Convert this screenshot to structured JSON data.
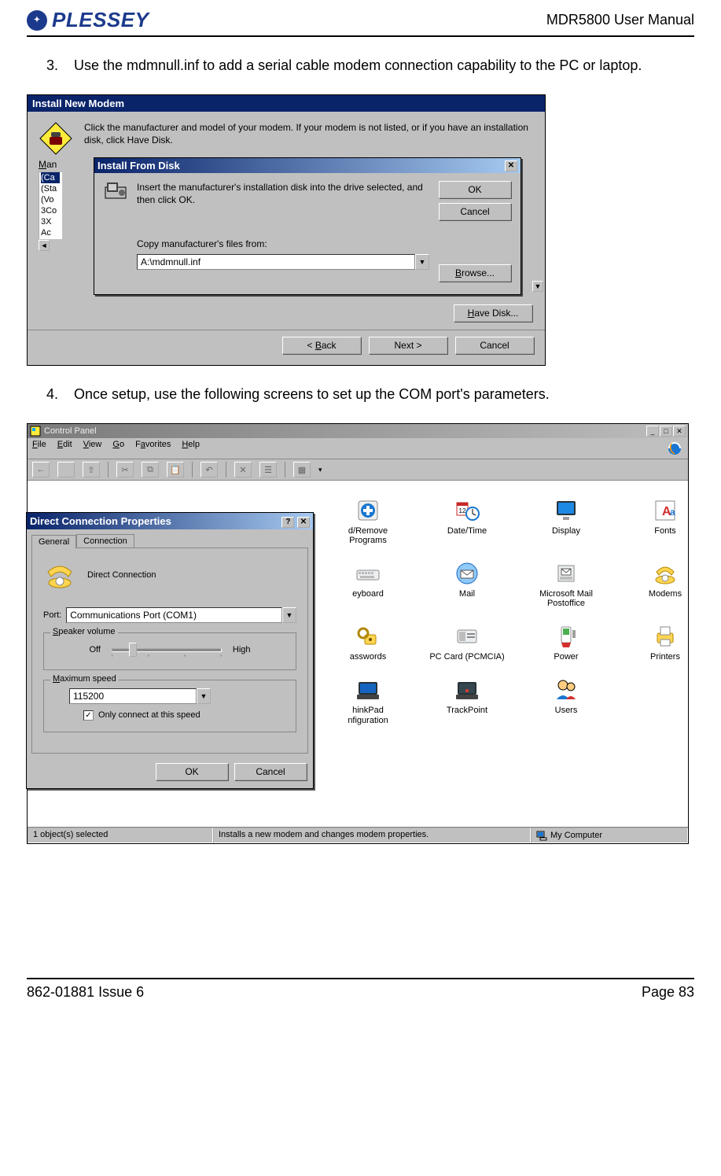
{
  "header": {
    "brand": "PLESSEY",
    "doc_title": "MDR5800 User Manual"
  },
  "footer": {
    "left": "862-01881 Issue 6",
    "right": "Page 83"
  },
  "step3": {
    "num": "3.",
    "text": "Use the mdmnull.inf to add a serial cable modem connection capability to the PC or laptop."
  },
  "step4": {
    "num": "4.",
    "text": "Once setup, use the following screens to set up the COM port's parameters."
  },
  "shot1": {
    "outer_title": "Install New Modem",
    "hint": "Click the manufacturer and model of your modem. If your modem is not listed, or if you have an installation disk, click Have Disk.",
    "mfr_label_u": "M",
    "mfr_label_rest": "an",
    "mfr_items": [
      "(Ca",
      "(Sta",
      "(Vo",
      "3Co",
      "3X",
      "Ac"
    ],
    "inner_title": "Install From Disk",
    "inner_hint": "Insert the manufacturer's installation disk into the drive selected, and then click OK.",
    "copy_from": "Copy manufacturer's files from:",
    "path_value": "A:\\mdmnull.inf",
    "ok": "OK",
    "cancel": "Cancel",
    "browse_u": "B",
    "browse_rest": "rowse...",
    "have_disk_u": "H",
    "have_disk_rest": "ave Disk...",
    "back_pre": "< ",
    "back_u": "B",
    "back_rest": "ack",
    "next": "Next >",
    "cancel2": "Cancel"
  },
  "shot2": {
    "cp_title": "Control Panel",
    "menu": {
      "file_u": "F",
      "file_r": "ile",
      "edit_u": "E",
      "edit_r": "dit",
      "view_u": "V",
      "view_r": "iew",
      "go_u": "G",
      "go_r": "o",
      "fav_u": "a",
      "fav_pre": "F",
      "fav_r": "vorites",
      "help_u": "H",
      "help_r": "elp"
    },
    "items": [
      {
        "name": "add-remove-programs-icon",
        "cap": "d/Remove\nPrograms"
      },
      {
        "name": "date-time-icon",
        "cap": "Date/Time"
      },
      {
        "name": "display-icon",
        "cap": "Display"
      },
      {
        "name": "fonts-icon",
        "cap": "Fonts"
      },
      {
        "name": "keyboard-icon",
        "cap": "eyboard"
      },
      {
        "name": "mail-icon",
        "cap": "Mail"
      },
      {
        "name": "ms-mail-postoffice-icon",
        "cap": "Microsoft Mail\nPostoffice"
      },
      {
        "name": "modems-icon",
        "cap": "Modems"
      },
      {
        "name": "passwords-icon",
        "cap": "asswords"
      },
      {
        "name": "pc-card-icon",
        "cap": "PC Card (PCMCIA)"
      },
      {
        "name": "power-icon",
        "cap": "Power"
      },
      {
        "name": "printers-icon",
        "cap": "Printers"
      },
      {
        "name": "thinkpad-config-icon",
        "cap": "hinkPad\nnfiguration"
      },
      {
        "name": "trackpoint-icon",
        "cap": "TrackPoint"
      },
      {
        "name": "users-icon",
        "cap": "Users"
      }
    ],
    "props_title": "Direct Connection Properties",
    "tab_general": "General",
    "tab_connection": "Connection",
    "device_name": "Direct Connection",
    "port_label_u": "P",
    "port_label_r": "ort:",
    "port_value": "Communications Port (COM1)",
    "speaker_legend_u": "S",
    "speaker_legend_r": "peaker volume",
    "off": "Off",
    "high": "High",
    "maxspeed_legend_u": "M",
    "maxspeed_legend_r": "aximum speed",
    "speed_value": "115200",
    "only_connect_u": "O",
    "only_connect_r": "nly connect at this speed",
    "ok": "OK",
    "cancel": "Cancel",
    "status_a": "1 object(s) selected",
    "status_b": "Installs a new modem and changes modem properties.",
    "status_c": "My Computer"
  }
}
